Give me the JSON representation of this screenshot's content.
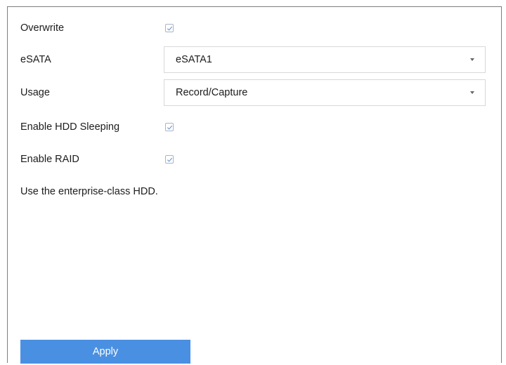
{
  "form": {
    "overwrite": {
      "label": "Overwrite",
      "checked": true
    },
    "esata": {
      "label": "eSATA",
      "value": "eSATA1"
    },
    "usage": {
      "label": "Usage",
      "value": "Record/Capture"
    },
    "hdd_sleeping": {
      "label": "Enable HDD Sleeping",
      "checked": true
    },
    "raid": {
      "label": "Enable RAID",
      "checked": true
    },
    "note": "Use the enterprise-class HDD."
  },
  "actions": {
    "apply_label": "Apply"
  },
  "colors": {
    "accent": "#4a90e2",
    "check": "#6b93d6",
    "panel_border": "#7d7d7d"
  },
  "icons": {
    "checkmark": "checkmark-icon",
    "dropdown": "chevron-down-icon"
  }
}
